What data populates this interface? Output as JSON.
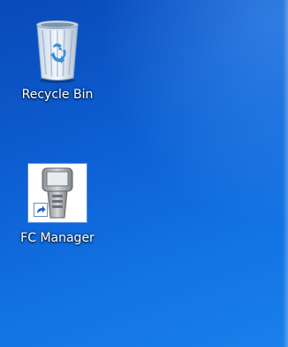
{
  "desktop": {
    "background_color": "#0d5fd2",
    "icons": [
      {
        "label": "Recycle Bin",
        "icon": "recycle-bin-icon"
      },
      {
        "label": "FC Manager",
        "icon": "fc-manager-device-icon",
        "shortcut": true
      }
    ]
  }
}
